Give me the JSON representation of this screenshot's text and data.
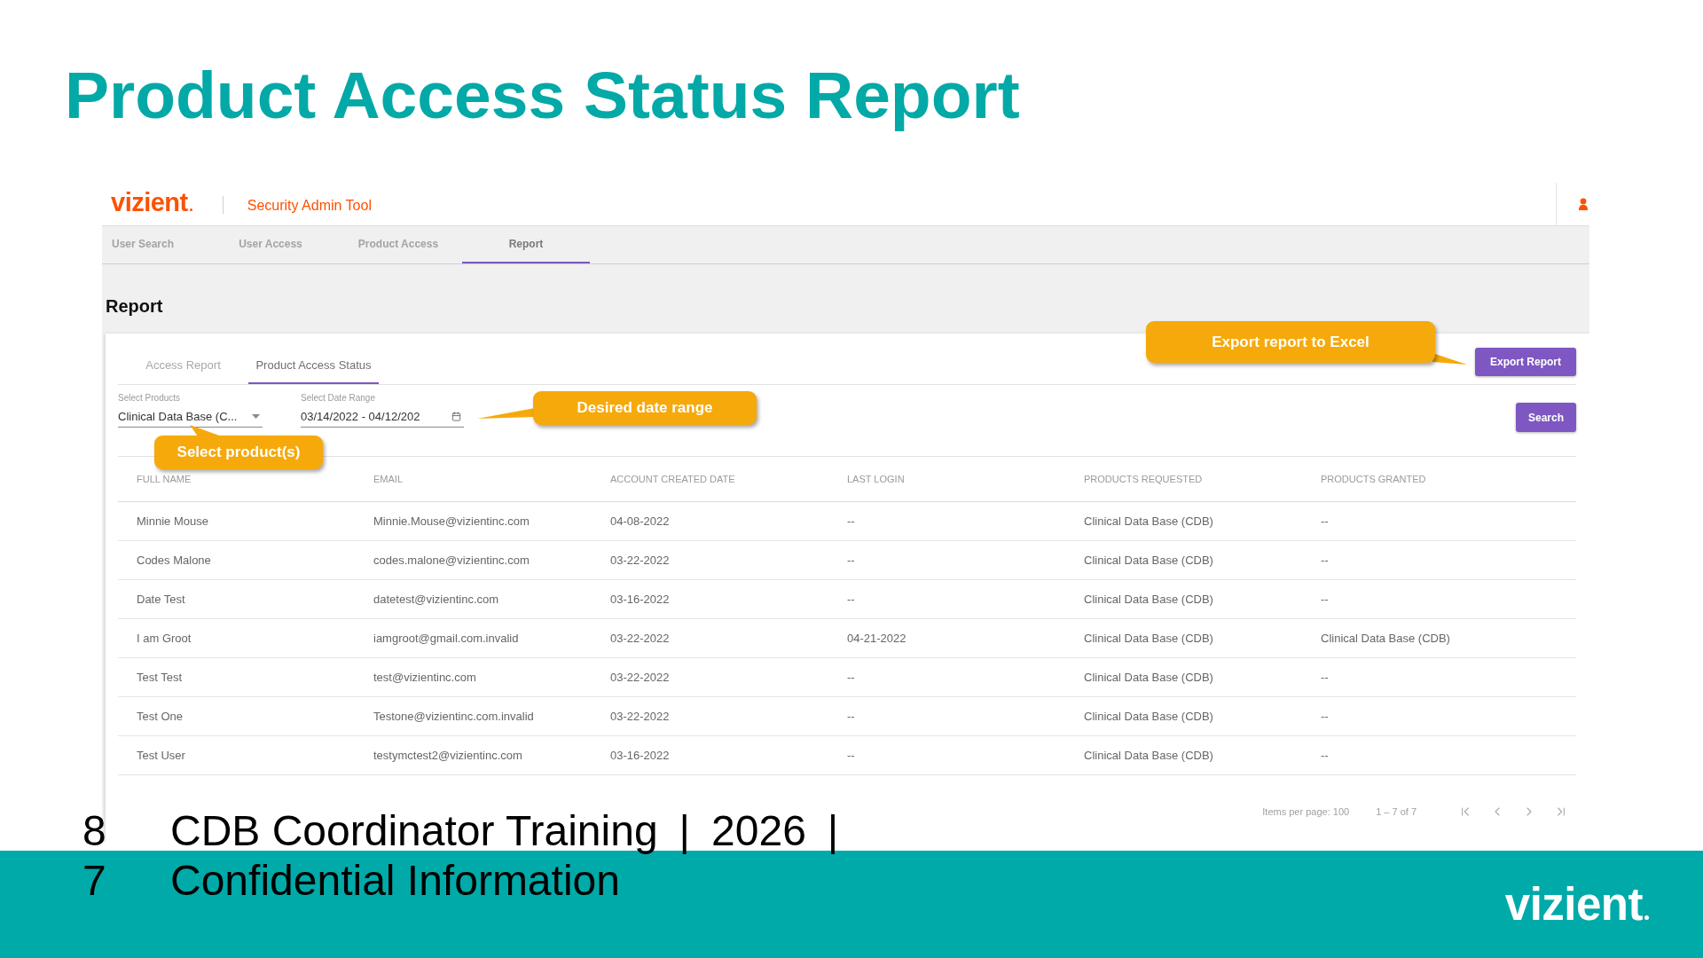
{
  "slide": {
    "title": "Product Access Status Report"
  },
  "app": {
    "logo": "vizient",
    "app_name": "Security Admin Tool",
    "nav_tabs": [
      {
        "label": "User Search",
        "selected": false
      },
      {
        "label": "User Access",
        "selected": false
      },
      {
        "label": "Product Access",
        "selected": false
      },
      {
        "label": "Report",
        "selected": true
      }
    ],
    "page_title": "Report",
    "report_tabs": [
      {
        "label": "Access Report",
        "selected": false
      },
      {
        "label": "Product Access Status",
        "selected": true
      }
    ],
    "export_button": "Export Report",
    "filters": [
      {
        "kind": "select",
        "label": "Select Products",
        "value": "Clinical Data Base (C..."
      },
      {
        "kind": "daterange",
        "label": "Select Date Range",
        "value": "03/14/2022 - 04/12/202"
      }
    ],
    "search_button": "Search",
    "table": {
      "columns": [
        "FULL NAME",
        "EMAIL",
        "ACCOUNT CREATED DATE",
        "LAST LOGIN",
        "PRODUCTS REQUESTED",
        "PRODUCTS GRANTED"
      ],
      "rows": [
        [
          "Minnie Mouse",
          "Minnie.Mouse@vizientinc.com",
          "04-08-2022",
          "--",
          "Clinical Data Base (CDB)",
          "--"
        ],
        [
          "Codes Malone",
          "codes.malone@vizientinc.com",
          "03-22-2022",
          "--",
          "Clinical Data Base (CDB)",
          "--"
        ],
        [
          "Date Test",
          "datetest@vizientinc.com",
          "03-16-2022",
          "--",
          "Clinical Data Base (CDB)",
          "--"
        ],
        [
          "I am Groot",
          "iamgroot@gmail.com.invalid",
          "03-22-2022",
          "04-21-2022",
          "Clinical Data Base (CDB)",
          "Clinical Data Base (CDB)"
        ],
        [
          "Test Test",
          "test@vizientinc.com",
          "03-22-2022",
          "--",
          "Clinical Data Base (CDB)",
          "--"
        ],
        [
          "Test One",
          "Testone@vizientinc.com.invalid",
          "03-22-2022",
          "--",
          "Clinical Data Base (CDB)",
          "--"
        ],
        [
          "Test User",
          "testymctest2@vizientinc.com",
          "03-16-2022",
          "--",
          "Clinical Data Base (CDB)",
          "--"
        ]
      ]
    },
    "pagination": {
      "items_per_page": "Items per page: 100",
      "range": "1 – 7 of 7"
    }
  },
  "callouts": [
    {
      "kind": "export",
      "text": "Export report to Excel"
    },
    {
      "kind": "daterange",
      "text": "Desired date range"
    },
    {
      "kind": "products",
      "text": "Select product(s)"
    }
  ],
  "footer": {
    "lines": [
      {
        "number": "8",
        "segments": [
          "CDB Coordinator Training",
          "|",
          "2026",
          "|"
        ]
      },
      {
        "number": "7",
        "segments": [
          "Confidential Information"
        ]
      }
    ],
    "logo": "vizient"
  }
}
